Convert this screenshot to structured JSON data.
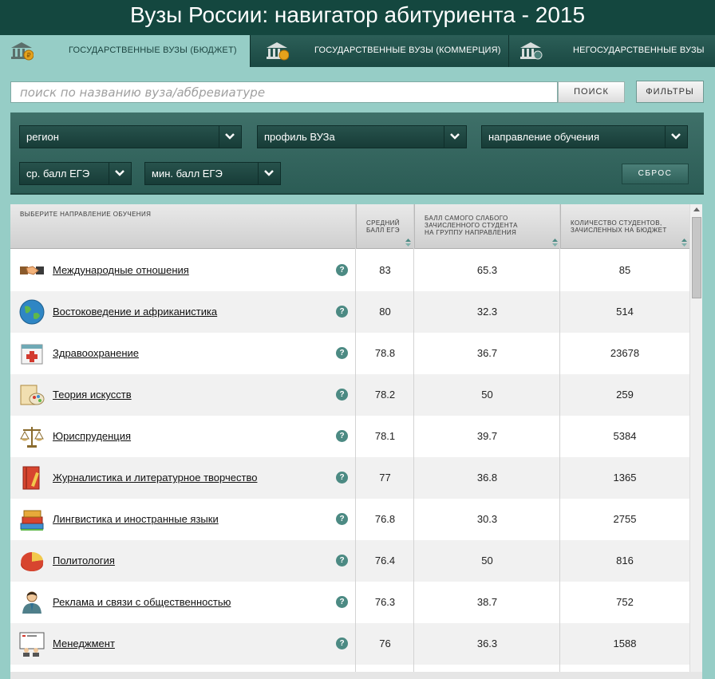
{
  "app_title": "Вузы России: навигатор абитуриента - 2015",
  "tabs": [
    {
      "label": "государственные вузы (бюджет)",
      "icon": "bank-ruble-icon",
      "active": true
    },
    {
      "label": "государственные вузы (коммерция)",
      "icon": "bank-coin-icon",
      "active": false
    },
    {
      "label": "негосударственные вузы",
      "icon": "bank-private-icon",
      "active": false
    }
  ],
  "search": {
    "placeholder": "поиск по названию вуза/аббревиатуре",
    "button_label": "поиск",
    "filters_label": "фильтры"
  },
  "filters": {
    "region": "регион",
    "profile": "профиль ВУЗа",
    "direction": "направление обучения",
    "avg_score": "ср. балл ЕГЭ",
    "min_score": "мин. балл ЕГЭ",
    "reset_label": "сброс"
  },
  "table": {
    "headers": {
      "direction": "выберите направление обучения",
      "avg_score": [
        "средний",
        "балл ЕГЭ"
      ],
      "weakest": [
        "балл самого слабого",
        "зачисленного студента",
        "на группу направления"
      ],
      "students": [
        "количество студентов,",
        "зачисленных на бюджет"
      ]
    },
    "rows": [
      {
        "name": "Международные отношения",
        "icon": "handshake-icon",
        "avg": "83",
        "weakest": "65.3",
        "students": "85"
      },
      {
        "name": "Востоковедение и африканистика",
        "icon": "globe-icon",
        "avg": "80",
        "weakest": "32.3",
        "students": "514"
      },
      {
        "name": "Здравоохранение",
        "icon": "medical-kit-icon",
        "avg": "78.8",
        "weakest": "36.7",
        "students": "23678"
      },
      {
        "name": "Теория искусств",
        "icon": "art-palette-icon",
        "avg": "78.2",
        "weakest": "50",
        "students": "259"
      },
      {
        "name": "Юриспруденция",
        "icon": "scales-icon",
        "avg": "78.1",
        "weakest": "39.7",
        "students": "5384"
      },
      {
        "name": "Журналистика и литературное творчество",
        "icon": "notebook-pencil-icon",
        "avg": "77",
        "weakest": "36.8",
        "students": "1365"
      },
      {
        "name": "Лингвистика и иностранные языки",
        "icon": "books-icon",
        "avg": "76.8",
        "weakest": "30.3",
        "students": "2755"
      },
      {
        "name": "Политология",
        "icon": "pie-chart-icon",
        "avg": "76.4",
        "weakest": "50",
        "students": "816"
      },
      {
        "name": "Реклама и связи с общественностью",
        "icon": "person-icon",
        "avg": "76.3",
        "weakest": "38.7",
        "students": "752"
      },
      {
        "name": "Менеджмент",
        "icon": "presentation-icon",
        "avg": "76",
        "weakest": "36.3",
        "students": "1588"
      }
    ]
  },
  "colors": {
    "title_bg": "#14473f",
    "page_bg": "#96cdc6",
    "filter_panel": "#336660",
    "help_icon": "#4c8a83"
  }
}
